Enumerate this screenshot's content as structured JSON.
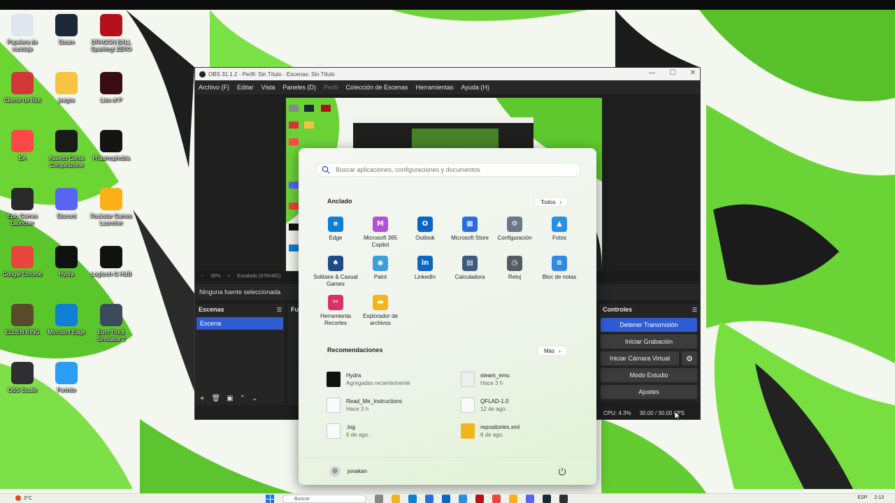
{
  "desktop": {
    "icons": [
      {
        "label": "Papelera de reciclaje",
        "icon": "recycle-bin-icon",
        "color": "#dfe6ee"
      },
      {
        "label": "Steam",
        "icon": "steam-icon",
        "color": "#1b2838"
      },
      {
        "label": "DRAGON BALL Sparking! ZERO",
        "icon": "dragon-ball-icon",
        "color": "#b3121b"
      },
      {
        "label": "Cliente de Riot",
        "icon": "riot-client-icon",
        "color": "#d13639"
      },
      {
        "label": "juegos",
        "icon": "folder-icon",
        "color": "#f5c542"
      },
      {
        "label": "Lies of P",
        "icon": "lies-of-p-icon",
        "color": "#3a0b12"
      },
      {
        "label": "EA",
        "icon": "ea-icon",
        "color": "#ff4747"
      },
      {
        "label": "Assetto Corsa Competizione",
        "icon": "assetto-corsa-icon",
        "color": "#1a1a1a"
      },
      {
        "label": "Phasmophobia",
        "icon": "phasmophobia-icon",
        "color": "#141414"
      },
      {
        "label": "Epic Games Launcher",
        "icon": "epic-games-icon",
        "color": "#2a2a2a"
      },
      {
        "label": "Discord",
        "icon": "discord-icon",
        "color": "#5865f2"
      },
      {
        "label": "Rockstar Games Launcher",
        "icon": "rockstar-icon",
        "color": "#fcaf17"
      },
      {
        "label": "Google Chrome",
        "icon": "chrome-icon",
        "color": "#e8453c"
      },
      {
        "label": "Hydra",
        "icon": "hydra-icon",
        "color": "#111111"
      },
      {
        "label": "Logitech G HUB",
        "icon": "logitech-icon",
        "color": "#111111"
      },
      {
        "label": "ELDEN RING",
        "icon": "elden-ring-icon",
        "color": "#5a4a2a"
      },
      {
        "label": "Microsoft Edge",
        "icon": "edge-icon",
        "color": "#0f7fd6"
      },
      {
        "label": "Euro Truck Simulator 2",
        "icon": "euro-truck-icon",
        "color": "#3b4a5a"
      },
      {
        "label": "OBS Studio",
        "icon": "obs-icon",
        "color": "#302e31"
      },
      {
        "label": "Fortnite",
        "icon": "fortnite-icon",
        "color": "#2a9df4"
      }
    ]
  },
  "obs": {
    "title": "OBS 31.1.2 - Perfil: Sin Título - Escenas: Sin Título",
    "window_controls": {
      "minimize": "—",
      "maximize": "☐",
      "close": "✕"
    },
    "menu": {
      "archivo": "Archivo (F)",
      "editar": "Editar",
      "vista": "Vista",
      "paneles": "Paneles (D)",
      "perfil": "Perfil",
      "coleccion": "Colección de Escenas",
      "herramientas": "Herramientas",
      "ayuda": "Ayuda (H)"
    },
    "zoom": {
      "minus": "−",
      "value": "35%",
      "plus": "+",
      "scale": "Escalado (678x381)"
    },
    "source_bar": "Ninguna fuente seleccionada",
    "scenes": {
      "title": "Escenas",
      "items": [
        "Escena"
      ],
      "tools": {
        "add": "+",
        "remove": "🗑",
        "filters": "▣",
        "up": "⌃",
        "down": "⌄"
      }
    },
    "sources": {
      "title": "Fu"
    },
    "controls": {
      "title": "Controles",
      "stop_stream": "Detener Transmisión",
      "start_recording": "Iniciar Grabación",
      "virtual_camera": "Iniciar Cámara Virtual",
      "studio_mode": "Modo Estudio",
      "settings": "Ajustes"
    },
    "status": {
      "cpu": "CPU: 4.3%",
      "fps": "30.00 / 30.00 FPS"
    }
  },
  "start_menu": {
    "search_placeholder": "Buscar aplicaciones, configuraciones y documentos",
    "pinned_title": "Anclado",
    "all_label": "Todos",
    "pinned": [
      {
        "label": "Edge",
        "icon": "edge-icon",
        "color": "#0f7fd6",
        "glyph": "e"
      },
      {
        "label": "Microsoft 365 Copilot",
        "icon": "m365-copilot-icon",
        "color": "#b34fd8",
        "glyph": "M"
      },
      {
        "label": "Outlook",
        "icon": "outlook-icon",
        "color": "#0a64c8",
        "glyph": "O"
      },
      {
        "label": "Microsoft Store",
        "icon": "store-icon",
        "color": "#2b6de0",
        "glyph": "▦"
      },
      {
        "label": "Configuración",
        "icon": "settings-gear-icon",
        "color": "#6a7887",
        "glyph": "⚙"
      },
      {
        "label": "Fotos",
        "icon": "photos-icon",
        "color": "#2a8fe0",
        "glyph": "▲"
      },
      {
        "label": "Solitaire & Casual Games",
        "icon": "solitaire-icon",
        "color": "#1f4a8a",
        "glyph": "♠"
      },
      {
        "label": "Paint",
        "icon": "paint-icon",
        "color": "#3aa0d8",
        "glyph": "◉"
      },
      {
        "label": "LinkedIn",
        "icon": "linkedin-icon",
        "color": "#0a66c2",
        "glyph": "in"
      },
      {
        "label": "Calculadora",
        "icon": "calculator-icon",
        "color": "#3d5a80",
        "glyph": "▤"
      },
      {
        "label": "Reloj",
        "icon": "clock-icon",
        "color": "#555b62",
        "glyph": "◷"
      },
      {
        "label": "Bloc de notas",
        "icon": "notepad-icon",
        "color": "#2f8be0",
        "glyph": "≡"
      },
      {
        "label": "Herramienta Recortes",
        "icon": "snipping-tool-icon",
        "color": "#d6336c",
        "glyph": "✂"
      },
      {
        "label": "Explorador de archivos",
        "icon": "file-explorer-icon",
        "color": "#f2b51d",
        "glyph": "▬"
      }
    ],
    "recommended_title": "Recomendaciones",
    "more_label": "Más",
    "recommended": [
      {
        "name": "Hydra",
        "sub": "Agregadas recientemente",
        "icon": "hydra-icon"
      },
      {
        "name": "steam_emu",
        "sub": "Hace 3 h",
        "icon": "settings-file-icon"
      },
      {
        "name": "Read_Me_Instructions",
        "sub": "Hace 3 h",
        "icon": "document-icon"
      },
      {
        "name": "QFLAD-1.0",
        "sub": "12 de ago.",
        "icon": "document-icon"
      },
      {
        "name": ".log",
        "sub": "6 de ago.",
        "icon": "document-icon"
      },
      {
        "name": "repositories.xml",
        "sub": "6 de ago.",
        "icon": "folder-zip-icon"
      }
    ],
    "user": "jonakan"
  },
  "taskbar": {
    "temperature": "3°C",
    "search_placeholder": "Buscar",
    "language": "ESP",
    "time": "2:13"
  }
}
